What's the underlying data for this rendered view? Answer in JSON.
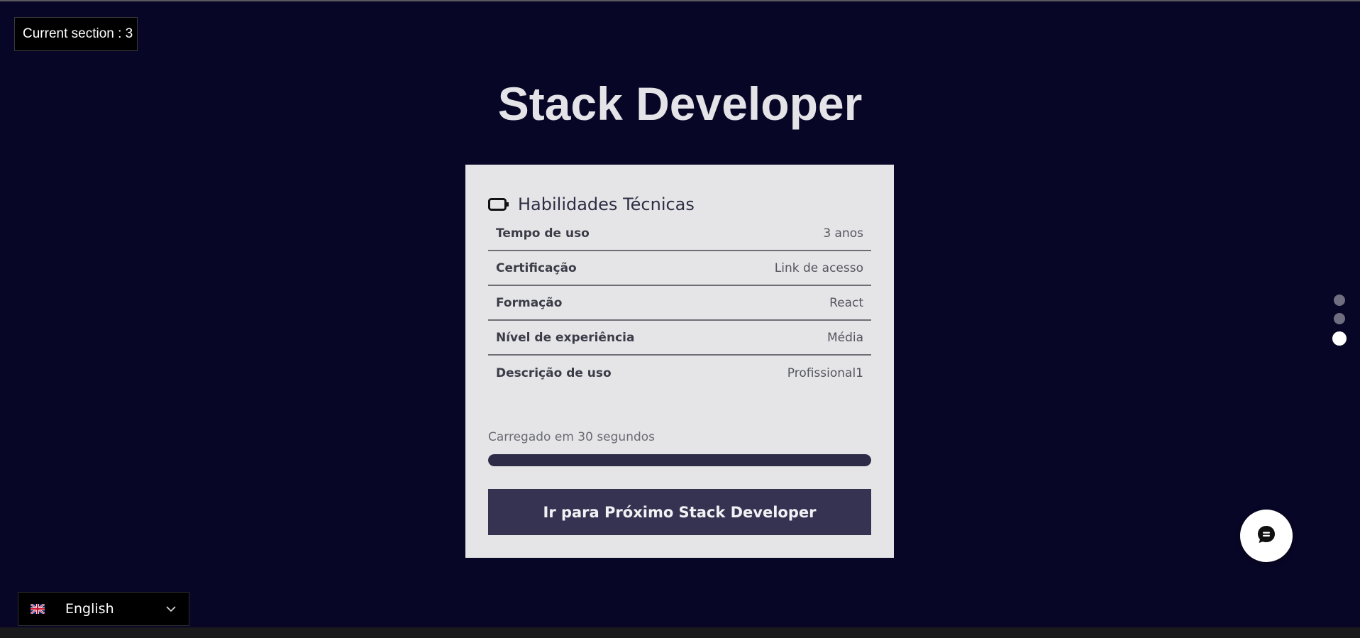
{
  "section_indicator": {
    "label": "Current section : 3"
  },
  "page": {
    "title": "Stack Developer"
  },
  "card": {
    "icon": "battery-icon",
    "title": "Habilidades Técnicas",
    "rows": [
      {
        "label": "Tempo de uso",
        "value": "3 anos"
      },
      {
        "label": "Certificação",
        "value": "Link de acesso"
      },
      {
        "label": "Formação",
        "value": "React"
      },
      {
        "label": "Nível de experiência",
        "value": "Média"
      },
      {
        "label": "Descrição de uso",
        "value": "Profissional1"
      }
    ],
    "load_text": "Carregado em 30 segundos",
    "progress_fraction": 1.0,
    "next_button_label": "Ir para Próximo Stack Developer"
  },
  "section_nav": {
    "count": 3,
    "active_index": 2
  },
  "chat": {
    "icon": "chat-bubble-icon"
  },
  "language": {
    "flag_icon": "uk-flag-icon",
    "selected": "English",
    "chevron_icon": "chevron-down-icon"
  },
  "colors": {
    "background": "#080626",
    "card": "#e5e5e8",
    "accent": "#363352",
    "progress": "#2d2b48"
  }
}
